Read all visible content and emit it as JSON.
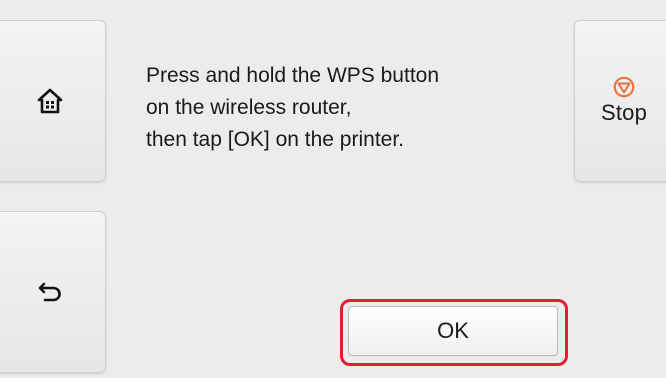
{
  "sidebar": {
    "home_icon": "home-icon",
    "back_icon": "back-arrow-icon"
  },
  "message": {
    "lines": [
      "Press and hold the WPS button",
      "on the wireless router,",
      "then tap [OK] on the printer."
    ]
  },
  "stop_button": {
    "label": "Stop",
    "icon": "stop-icon",
    "icon_color": "#e8743b"
  },
  "ok_button": {
    "label": "OK",
    "highlight_color": "#e0202b"
  }
}
